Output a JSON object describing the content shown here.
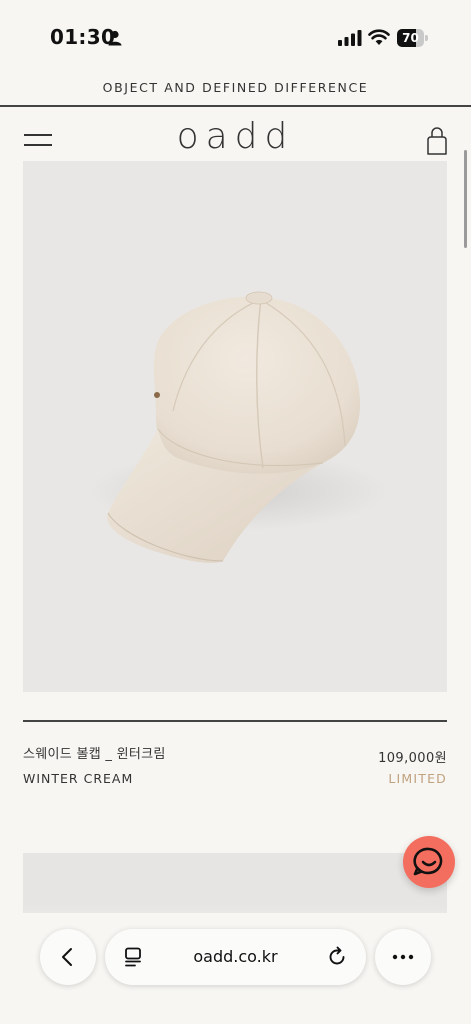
{
  "status_bar": {
    "time": "01:30",
    "battery": "70",
    "battery_level": 0.7
  },
  "header": {
    "tagline": "OBJECT AND DEFINED DIFFERENCE",
    "logo": "oadd"
  },
  "product": {
    "name_ko": "스웨이드 볼캡 _ 윈터크림",
    "name_en": "WINTER CREAM",
    "price": "109,000원",
    "badge": "LIMITED"
  },
  "browser": {
    "url": "oadd.co.kr"
  },
  "icons": {
    "status": [
      "person-icon",
      "signal-icon",
      "wifi-icon",
      "battery-icon"
    ],
    "header": [
      "menu-icon",
      "shopping-bag-icon"
    ],
    "chat": "chat-icon",
    "browser": [
      "chevron-left-icon",
      "tabs-icon",
      "reload-icon",
      "more-icon"
    ]
  },
  "colors": {
    "background": "#f7f6f3",
    "chat_button": "#f36e5e",
    "limited_badge": "#c0a27f",
    "image_bg": "#e8e7e5"
  }
}
